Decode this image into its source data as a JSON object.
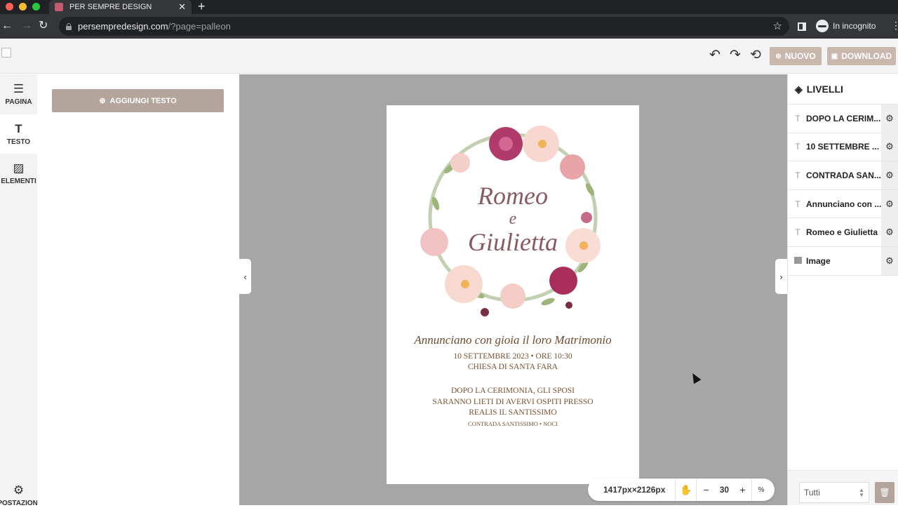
{
  "browser": {
    "tab_title": "PER SEMPRE DESIGN",
    "url_host": "persempredesign.com",
    "url_path": "/?page=palleon",
    "incognito_label": "In incognito"
  },
  "header": {
    "new_label": "NUOVO",
    "download_label": "DOWNLOAD"
  },
  "rail": {
    "items": [
      {
        "label": "PAGINA",
        "icon": "sliders-icon"
      },
      {
        "label": "TESTO",
        "icon": "text-icon"
      },
      {
        "label": "ELEMENTI",
        "icon": "add-image-icon"
      },
      {
        "label": "POSTAZIONI",
        "icon": "gear-icon"
      }
    ]
  },
  "toolpanel": {
    "add_text_label": "AGGIUNGI TESTO"
  },
  "invitation": {
    "name1": "Romeo",
    "name2": "e",
    "name3": "Giulietta",
    "announce": "Annunciano con gioia il loro Matrimonio",
    "date": "10 SETTEMBRE 2023 • ORE 10:30\nCHIESA DI SANTA FARA",
    "after": "DOPO LA CERIMONIA, GLI SPOSI\nSARANNO LIETI DI AVERVI OSPITI PRESSO\nREALIS IL SANTISSIMO",
    "address": "CONTRADA SANTISSIMO • NOCI"
  },
  "zoombar": {
    "dimensions": "1417px×2126px",
    "zoom": "30",
    "unit": "%"
  },
  "layers": {
    "title": "LIVELLI",
    "items": [
      {
        "label": "DOPO LA CERIM...",
        "type": "text"
      },
      {
        "label": "10 SETTEMBRE ...",
        "type": "text"
      },
      {
        "label": "CONTRADA SAN...",
        "type": "text"
      },
      {
        "label": "Annunciano con ...",
        "type": "text"
      },
      {
        "label": "Romeo e Giulietta",
        "type": "text"
      },
      {
        "label": "Image",
        "type": "image"
      }
    ],
    "filter_value": "Tutti"
  },
  "colors": {
    "accent_button": "#c9b7ad",
    "add_text_button": "#b3a49c",
    "canvas_bg": "#a6a6a6",
    "names_color": "#8a5a63",
    "text_brown": "#7a5234"
  }
}
